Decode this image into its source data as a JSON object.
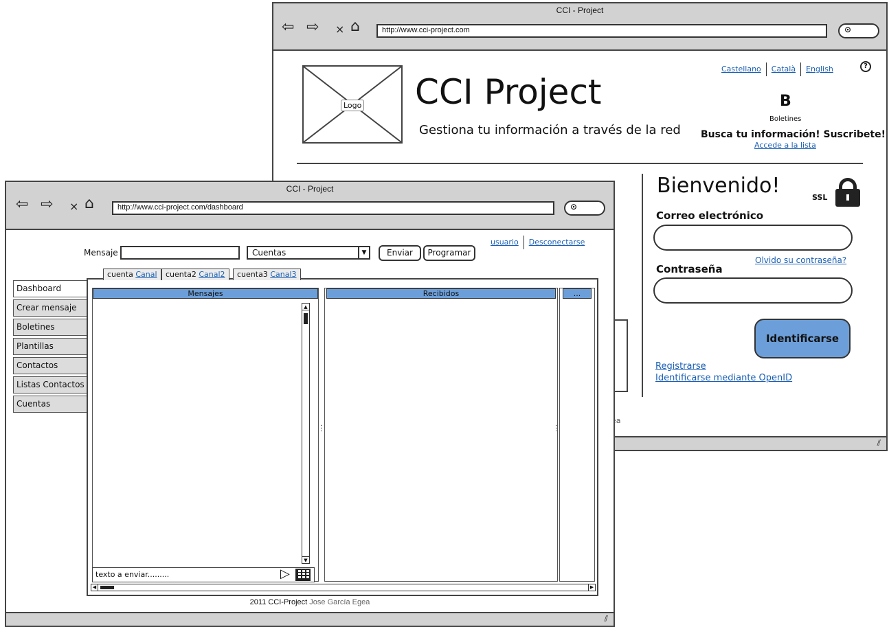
{
  "back_window": {
    "title": "CCI - Project",
    "url": "http://www.cci-project.com",
    "logo_label": "Logo",
    "site_title": "CCI Project",
    "tagline": "Gestiona tu información a través de la red",
    "languages": [
      "Castellano",
      "Català",
      "English"
    ],
    "help_symbol": "?",
    "boletines_icon_letter": "B",
    "boletines_label": "Boletines",
    "subscribe_text": "Busca tu información! Suscribete!",
    "list_link": "Accede a la lista",
    "welcome": "Bienvenido!",
    "ssl_label": "SSL",
    "email_label": "Correo electrónico",
    "email_value": "",
    "forgot_link": "Olvido su contraseña?",
    "password_label": "Contraseña",
    "password_value": "",
    "login_button": "Identificarse",
    "register_link": "Registrarse",
    "openid_link": "Identificarse mediante OpenID",
    "footer_fragment": "Egea"
  },
  "front_window": {
    "title": "CCI - Project",
    "url": "http://www.cci-project.com/dashboard",
    "user_link": "usuario",
    "logout_link": "Desconectarse",
    "message_label": "Mensaje",
    "message_value": "",
    "account_select": "Cuentas",
    "send_button": "Enviar",
    "schedule_button": "Programar",
    "sidebar": [
      "Dashboard",
      "Crear mensaje",
      "Boletines",
      "Plantillas",
      "Contactos",
      "Listas Contactos",
      "Cuentas"
    ],
    "tabs": [
      {
        "account": "cuenta",
        "channel": "Canal"
      },
      {
        "account": "cuenta2",
        "channel": "Canal2"
      },
      {
        "account": "cuenta3",
        "channel": "Canal3"
      }
    ],
    "columns": [
      "Mensajes",
      "Recibidos",
      "..."
    ],
    "compose_text": "texto a enviar.........",
    "footer_text": "2011 CCI-Project",
    "footer_author": "Jose García Egea"
  },
  "colors": {
    "accent_blue": "#6c9fd9",
    "link_blue": "#1a5fb4",
    "chrome_gray": "#d2d2d2"
  },
  "icons": [
    "back-arrow-icon",
    "forward-arrow-icon",
    "close-icon",
    "home-icon",
    "search-icon",
    "help-icon",
    "boletines-icon",
    "lock-icon",
    "send-icon",
    "calendar-icon",
    "resize-grip-icon"
  ]
}
